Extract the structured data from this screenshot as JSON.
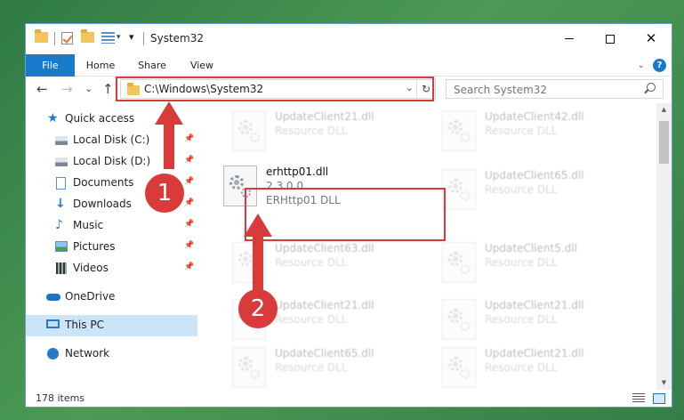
{
  "window": {
    "title": "System32",
    "qa_dropdown_glyph": "▾",
    "minimize_glyph": "",
    "close_glyph": "✕"
  },
  "ribbon": {
    "tabs": [
      "File",
      "Home",
      "Share",
      "View"
    ],
    "collapse_glyph": "⌄",
    "help_glyph": "?"
  },
  "nav": {
    "back_glyph": "←",
    "forward_glyph": "→",
    "recent_glyph": "⌄",
    "up_glyph": "↑",
    "address": "C:\\Windows\\System32",
    "address_dropdown_glyph": "⌄",
    "refresh_glyph": "↻",
    "search_placeholder": "Search System32"
  },
  "sidebar": {
    "items": [
      {
        "label": "Quick access",
        "icon": "star-icon",
        "pinned": false
      },
      {
        "label": "Local Disk (C:)",
        "icon": "disk-icon",
        "pinned": true
      },
      {
        "label": "Local Disk (D:)",
        "icon": "disk-icon",
        "pinned": true
      },
      {
        "label": "Documents",
        "icon": "document-icon",
        "pinned": true
      },
      {
        "label": "Downloads",
        "icon": "download-icon",
        "pinned": true
      },
      {
        "label": "Music",
        "icon": "music-icon",
        "pinned": true
      },
      {
        "label": "Pictures",
        "icon": "pictures-icon",
        "pinned": true
      },
      {
        "label": "Videos",
        "icon": "video-icon",
        "pinned": true
      },
      {
        "label": "OneDrive",
        "icon": "cloud-icon",
        "pinned": false
      },
      {
        "label": "This PC",
        "icon": "computer-icon",
        "pinned": false,
        "selected": true
      },
      {
        "label": "Network",
        "icon": "network-icon",
        "pinned": false
      }
    ],
    "pin_glyph": "📌"
  },
  "files": {
    "highlighted": {
      "name": "erhttp01.dll",
      "version": "2.3.0.0",
      "description": "ERHttp01 DLL"
    },
    "background": [
      {
        "name": "UpdateClient21.dll",
        "description": "Resource DLL"
      },
      {
        "name": "UpdateClient42.dll",
        "description": "Resource DLL"
      },
      {
        "name": "UpdateClient65.dll",
        "description": "Resource DLL"
      },
      {
        "name": "UpdateClient63.dll",
        "description": "Resource DLL"
      },
      {
        "name": "UpdateClient5.dll",
        "description": "Resource DLL"
      },
      {
        "name": "UpdateClient21.dll",
        "description": "Resource DLL"
      },
      {
        "name": "UpdateClient21.dll",
        "description": "Resource DLL"
      },
      {
        "name": "UpdateClient65.dll",
        "description": "Resource DLL"
      },
      {
        "name": "UpdateClient21.dll",
        "description": "Resource DLL"
      }
    ]
  },
  "scrollbar": {
    "up_glyph": "▲",
    "down_glyph": "▼"
  },
  "status": {
    "item_count": "178 items"
  },
  "callouts": [
    "1",
    "2"
  ],
  "colors": {
    "accent": "#1979ca",
    "highlight": "#d93b3b",
    "selected": "#cce4f7"
  }
}
